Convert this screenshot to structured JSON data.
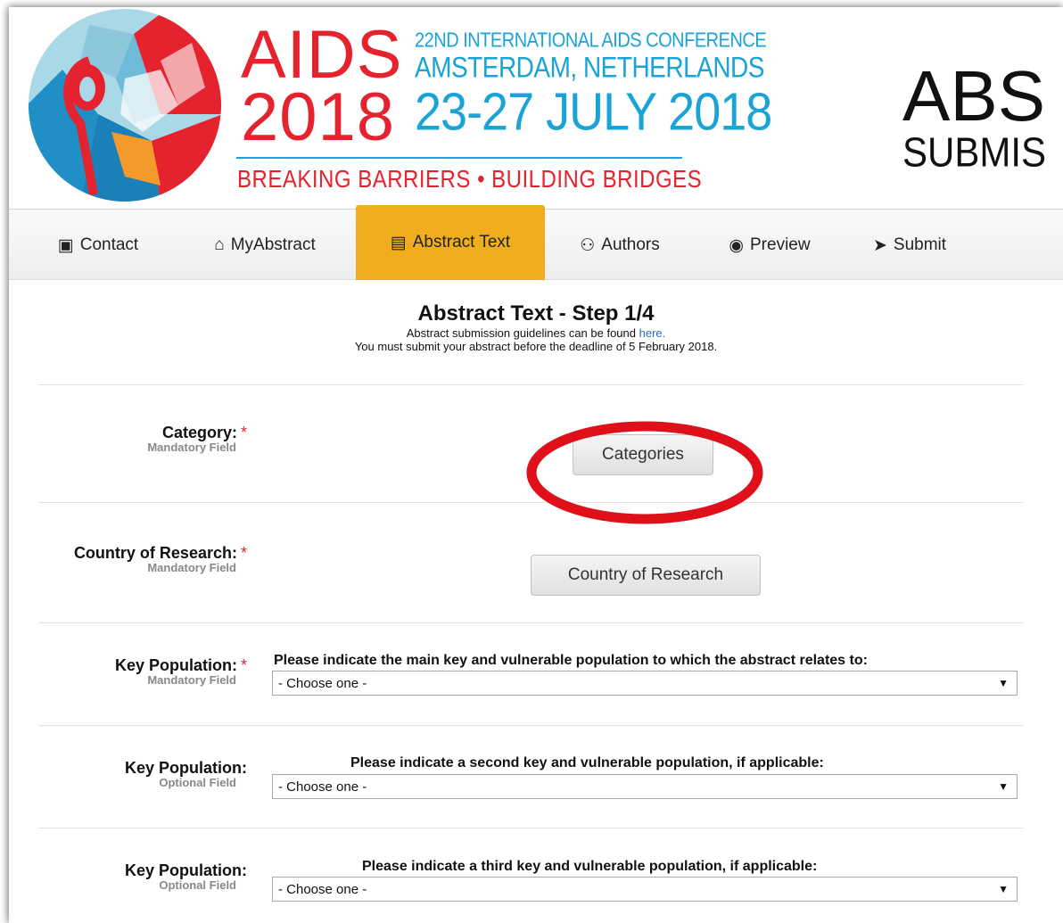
{
  "header": {
    "logo": {
      "word": "AIDS",
      "year": "2018",
      "conference": "22ND INTERNATIONAL AIDS CONFERENCE",
      "city": "AMSTERDAM, NETHERLANDS",
      "dates": "23-27 JULY 2018",
      "tagline": "BREAKING BARRIERS • BUILDING BRIDGES"
    },
    "title": "ABS",
    "subtitle": "SUBMIS"
  },
  "nav": {
    "items": [
      {
        "label": "Contact",
        "icon": "contact-card-icon",
        "glyph": "▣"
      },
      {
        "label": "MyAbstract",
        "icon": "home-icon",
        "glyph": "⌂"
      },
      {
        "label": "Abstract Text",
        "icon": "document-icon",
        "glyph": "▤",
        "active": true
      },
      {
        "label": "Authors",
        "icon": "users-icon",
        "glyph": "⚇"
      },
      {
        "label": "Preview",
        "icon": "eye-icon",
        "glyph": "◉"
      },
      {
        "label": "Submit",
        "icon": "send-icon",
        "glyph": "➤"
      }
    ]
  },
  "page": {
    "title": "Abstract Text - Step 1/4",
    "guidelines_prefix": "Abstract submission guidelines can be found ",
    "guidelines_link": "here.",
    "deadline_note": "You must submit your abstract before the deadline of 5 February 2018."
  },
  "form": {
    "category": {
      "label": "Category:",
      "required_mark": "*",
      "hint": "Mandatory Field",
      "button": "Categories"
    },
    "country": {
      "label": "Country of Research:",
      "required_mark": "*",
      "hint": "Mandatory Field",
      "button": "Country of Research"
    },
    "key_population_1": {
      "label": "Key Population:",
      "required_mark": "*",
      "hint": "Mandatory Field",
      "prompt": "Please indicate the main key and vulnerable population to which the abstract relates to:",
      "selected": "- Choose one -"
    },
    "key_population_2": {
      "label": "Key Population:",
      "hint": "Optional Field",
      "prompt": "Please indicate a second key and vulnerable population, if applicable:",
      "selected": "- Choose one -"
    },
    "key_population_3": {
      "label": "Key Population:",
      "hint": "Optional Field",
      "prompt": "Please indicate a third key and vulnerable population, if applicable:",
      "selected": "- Choose one -"
    }
  },
  "colors": {
    "brand_red": "#e4232e",
    "brand_blue": "#1aa3d6",
    "nav_active": "#f0ad1e",
    "annotation": "#e0101a"
  }
}
